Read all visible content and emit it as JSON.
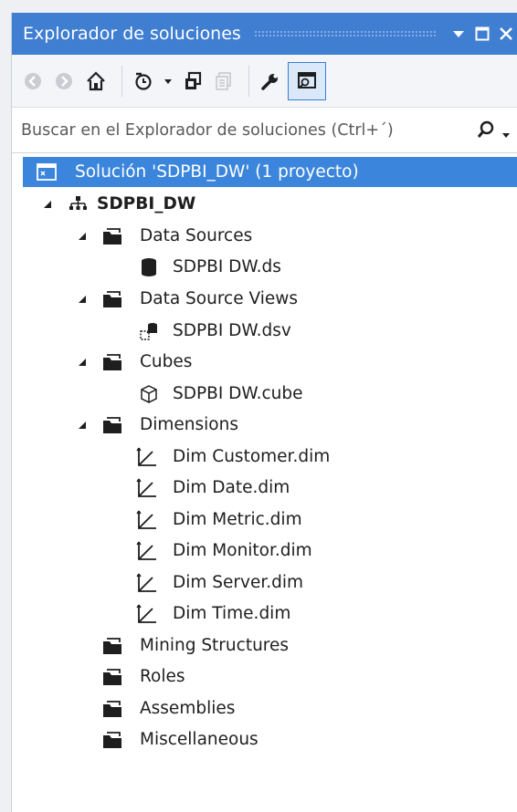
{
  "window": {
    "title": "Explorador de soluciones",
    "controls": [
      "dropdown-icon",
      "maximize-icon",
      "close-icon"
    ]
  },
  "toolbar": {
    "buttons": [
      "back-icon",
      "forward-icon",
      "home-icon",
      "history-icon",
      "dropdown-icon",
      "sync-icon",
      "properties-icon",
      "wrench-icon",
      "show-all-files-icon"
    ]
  },
  "search": {
    "placeholder": "Buscar en el Explorador de soluciones (Ctrl+´)"
  },
  "tree": {
    "solution": "Solución 'SDPBI_DW'  (1 proyecto)",
    "project": "SDPBI_DW",
    "data_sources": {
      "label": "Data Sources",
      "items": [
        "SDPBI DW.ds"
      ]
    },
    "data_source_views": {
      "label": "Data Source Views",
      "items": [
        "SDPBI DW.dsv"
      ]
    },
    "cubes": {
      "label": "Cubes",
      "items": [
        "SDPBI DW.cube"
      ]
    },
    "dimensions": {
      "label": "Dimensions",
      "items": [
        "Dim Customer.dim",
        "Dim Date.dim",
        "Dim Metric.dim",
        "Dim Monitor.dim",
        "Dim Server.dim",
        "Dim Time.dim"
      ]
    },
    "mining_structures": "Mining Structures",
    "roles": "Roles",
    "assemblies": "Assemblies",
    "miscellaneous": "Miscellaneous"
  },
  "colors": {
    "titlebar": "#3f7ed1",
    "selection": "#3b86dc",
    "toolbar": "#f4f5f8"
  }
}
